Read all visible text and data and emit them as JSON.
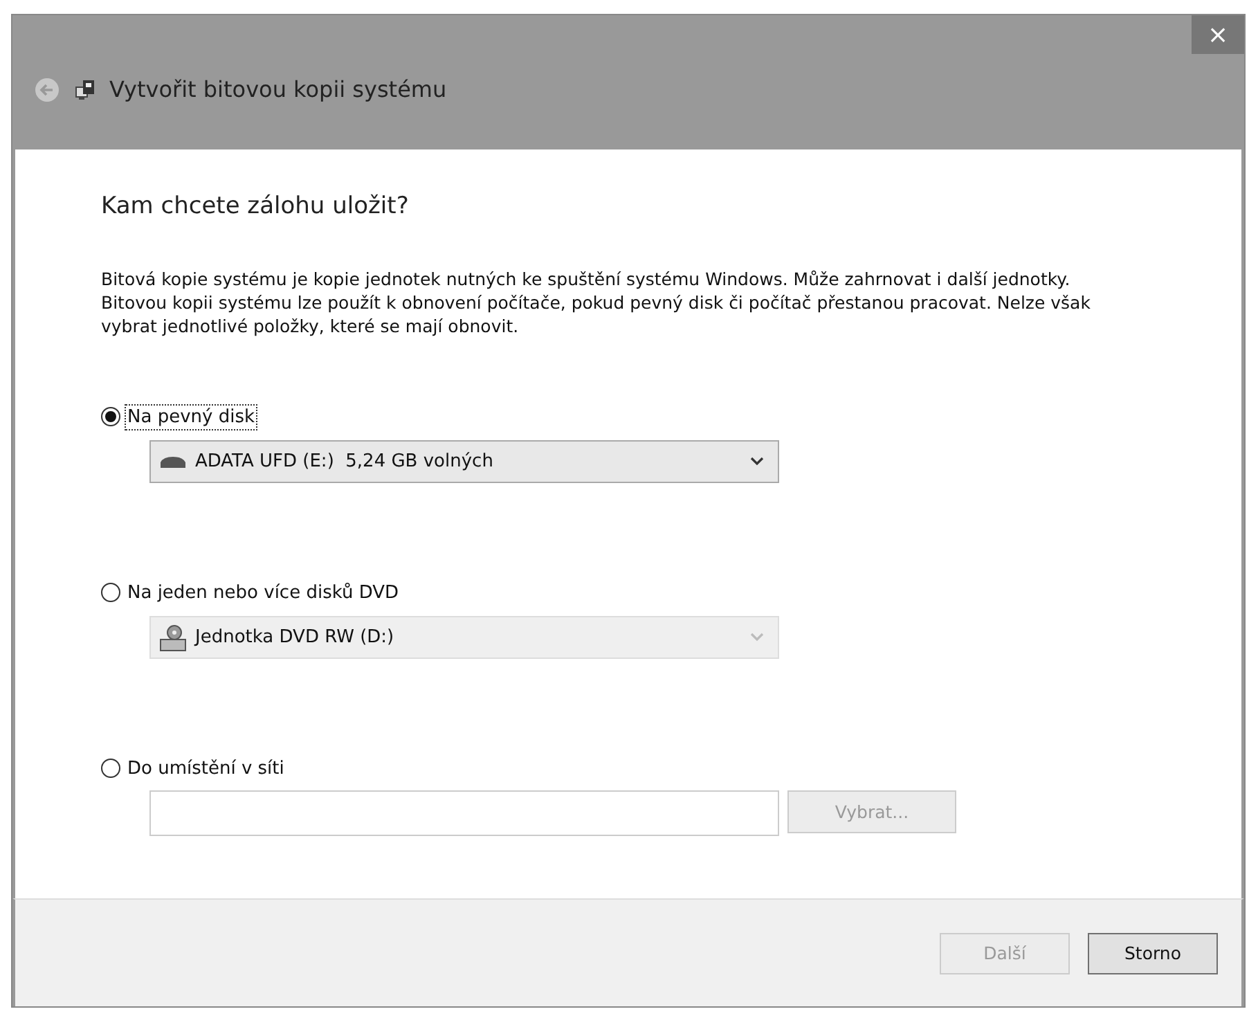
{
  "window": {
    "title": "Vytvořit bitovou kopii systému",
    "close": "×"
  },
  "heading": "Kam chcete zálohu uložit?",
  "description": "Bitová kopie systému je kopie jednotek nutných ke spuštění systému Windows. Může zahrnovat i další jednotky. Bitovou kopii systému lze použít k obnovení počítače, pokud pevný disk či počítač přestanou pracovat. Nelze však vybrat jednotlivé položky, které se mají obnovit.",
  "options": [
    {
      "label": "Na pevný disk",
      "selected": true,
      "kind": "disk",
      "value": "ADATA UFD (E:)  5,24 GB volných",
      "disabled": false
    },
    {
      "label": "Na jeden nebo více disků DVD",
      "selected": false,
      "kind": "dvd",
      "value": "Jednotka DVD RW (D:)",
      "disabled": true
    },
    {
      "label": "Do umístění v síti",
      "selected": false,
      "kind": "network",
      "button": "Vybrat...",
      "disabled": true
    }
  ],
  "buttons": [
    {
      "label": "Další",
      "disabled": true
    },
    {
      "label": "Storno",
      "disabled": false
    }
  ]
}
